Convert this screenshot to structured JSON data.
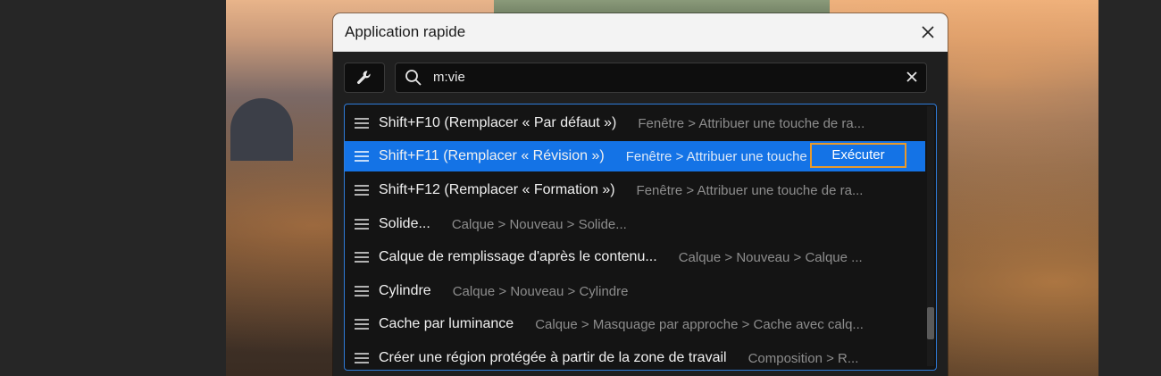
{
  "dialog": {
    "title": "Application rapide"
  },
  "search": {
    "value": "m:vie"
  },
  "results": [
    {
      "label": "Shift+F10 (Remplacer « Par défaut »)",
      "path": "Fenêtre > Attribuer une touche de ra..."
    },
    {
      "label": "Shift+F11 (Remplacer « Révision »)",
      "path": "Fenêtre > Attribuer une touche de ra...",
      "selected": true
    },
    {
      "label": "Shift+F12 (Remplacer « Formation »)",
      "path": "Fenêtre > Attribuer une touche de ra..."
    },
    {
      "label": "Solide...",
      "path": "Calque > Nouveau > Solide..."
    },
    {
      "label": "Calque de remplissage d'après le contenu...",
      "path": "Calque > Nouveau > Calque ..."
    },
    {
      "label": "Cylindre",
      "path": "Calque > Nouveau > Cylindre"
    },
    {
      "label": "Cache par luminance",
      "path": "Calque > Masquage par approche > Cache avec calq..."
    },
    {
      "label": "Créer une région protégée à partir de la zone de travail",
      "path": "Composition > R..."
    }
  ],
  "execute_label": "Exécuter",
  "colors": {
    "accent": "#1473e6",
    "focus_ring": "#e89a2c"
  }
}
